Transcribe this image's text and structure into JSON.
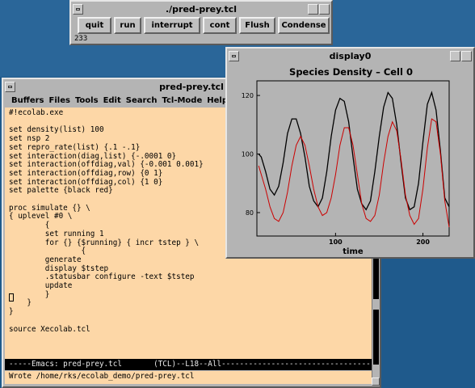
{
  "control_window": {
    "title": "./pred-prey.tcl",
    "buttons": [
      "quit",
      "run",
      "interrupt",
      "cont",
      "Flush",
      "Condense"
    ],
    "status_value": "233"
  },
  "emacs_window": {
    "title": "pred-prey.tcl",
    "menu": [
      "Buffers",
      "Files",
      "Tools",
      "Edit",
      "Search",
      "Tcl-Mode",
      "Help"
    ],
    "code": "#!ecolab.exe\n\nset density(list) 100\nset nsp 2\nset repro_rate(list) {.1 -.1}\nset interaction(diag,list) {-.0001 0}\nset interaction(offdiag,val) {-0.001 0.001}\nset interaction(offdiag,row) {0 1}\nset interaction(offdiag,col) {1 0}\nset palette {black red}\n\nproc simulate {} \\\n{ uplevel #0 \\\n        {\n        set running 1\n        for {} {$running} { incr tstep } \\\n                {\n        generate\n        display $tstep\n        .statusbar configure -text $tstep\n        update\n        }\n    }\n}\n\nsource Xecolab.tcl",
    "modeline": "-----Emacs: pred-prey.tcl       (TCL)--L18--All---------------------------------",
    "echo": "Wrote /home/rks/ecolab_demo/pred-prey.tcl"
  },
  "display_window": {
    "title": "display0"
  },
  "chart_data": {
    "type": "line",
    "title": "Species Density – Cell 0",
    "xlabel": "time",
    "ylabel": "",
    "xlim": [
      10,
      230
    ],
    "ylim": [
      72,
      125
    ],
    "xticks": [
      "100",
      "200"
    ],
    "yticks": [
      "80",
      "100",
      "120"
    ],
    "series": [
      {
        "color": "#000000",
        "x": [
          12,
          15,
          20,
          25,
          30,
          35,
          40,
          45,
          50,
          55,
          60,
          65,
          70,
          75,
          80,
          85,
          90,
          95,
          100,
          105,
          110,
          115,
          120,
          125,
          130,
          135,
          140,
          145,
          150,
          155,
          160,
          165,
          170,
          175,
          180,
          185,
          190,
          195,
          200,
          205,
          210,
          215,
          220,
          225,
          230
        ],
        "y": [
          100,
          99,
          94,
          88,
          86,
          89,
          97,
          107,
          112,
          112,
          107,
          99,
          89,
          84,
          82,
          85,
          94,
          106,
          115,
          119,
          118,
          111,
          99,
          88,
          83,
          81,
          84,
          94,
          106,
          116,
          121,
          119,
          110,
          97,
          85,
          81,
          82,
          90,
          104,
          117,
          121,
          115,
          101,
          85,
          82
        ]
      },
      {
        "color": "#cc0000",
        "x": [
          12,
          15,
          20,
          25,
          30,
          35,
          40,
          45,
          50,
          55,
          60,
          65,
          70,
          75,
          80,
          85,
          90,
          95,
          100,
          105,
          110,
          115,
          120,
          125,
          130,
          135,
          140,
          145,
          150,
          155,
          160,
          165,
          170,
          175,
          180,
          185,
          190,
          195,
          200,
          205,
          210,
          215,
          220,
          225,
          230
        ],
        "y": [
          96,
          93,
          88,
          82,
          78,
          77,
          80,
          87,
          96,
          103,
          106,
          103,
          96,
          88,
          82,
          79,
          80,
          85,
          93,
          103,
          109,
          109,
          103,
          93,
          83,
          78,
          77,
          79,
          86,
          97,
          106,
          111,
          108,
          98,
          86,
          79,
          76,
          78,
          88,
          102,
          112,
          111,
          100,
          84,
          75
        ]
      }
    ]
  }
}
